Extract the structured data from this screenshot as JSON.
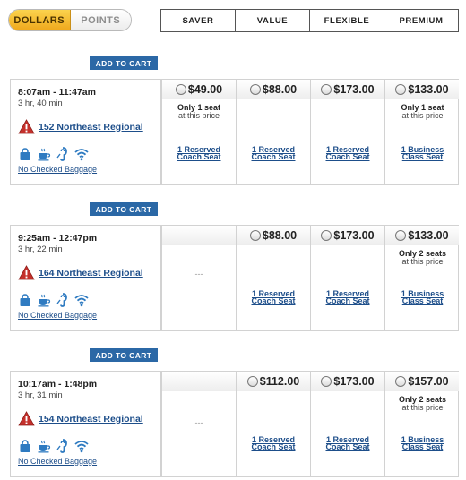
{
  "toggle": {
    "dollars": "DOLLARS",
    "points": "POINTS"
  },
  "columns": [
    "SAVER",
    "VALUE",
    "FLEXIBLE",
    "PREMIUM"
  ],
  "add_to_cart": "ADD TO CART",
  "no_fare": "---",
  "no_baggage": "No Checked Baggage",
  "flights": [
    {
      "times": "8:07am - 11:47am",
      "duration": "3 hr, 40 min",
      "flight": "152 Northeast Regional",
      "prices": [
        "$49.00",
        "$88.00",
        "$173.00",
        "$133.00"
      ],
      "seats": [
        {
          "line1": "Only 1 seat",
          "line2": "at this price"
        },
        null,
        null,
        {
          "line1": "Only 1 seat",
          "line2": "at this price"
        }
      ],
      "fares": [
        {
          "l1": "1 Reserved",
          "l2": "Coach Seat"
        },
        {
          "l1": "1 Reserved",
          "l2": "Coach Seat"
        },
        {
          "l1": "1 Reserved",
          "l2": "Coach Seat"
        },
        {
          "l1": "1 Business",
          "l2": "Class Seat"
        }
      ]
    },
    {
      "times": "9:25am - 12:47pm",
      "duration": "3 hr, 22 min",
      "flight": "164 Northeast Regional",
      "prices": [
        null,
        "$88.00",
        "$173.00",
        "$133.00"
      ],
      "seats": [
        null,
        null,
        null,
        {
          "line1": "Only 2 seats",
          "line2": "at this price"
        }
      ],
      "fares": [
        null,
        {
          "l1": "1 Reserved",
          "l2": "Coach Seat"
        },
        {
          "l1": "1 Reserved",
          "l2": "Coach Seat"
        },
        {
          "l1": "1 Business",
          "l2": "Class Seat"
        }
      ]
    },
    {
      "times": "10:17am - 1:48pm",
      "duration": "3 hr, 31 min",
      "flight": "154 Northeast Regional",
      "prices": [
        null,
        "$112.00",
        "$173.00",
        "$157.00"
      ],
      "seats": [
        null,
        null,
        null,
        {
          "line1": "Only 2 seats",
          "line2": "at this price"
        }
      ],
      "fares": [
        null,
        {
          "l1": "1 Reserved",
          "l2": "Coach Seat"
        },
        {
          "l1": "1 Reserved",
          "l2": "Coach Seat"
        },
        {
          "l1": "1 Business",
          "l2": "Class Seat"
        }
      ]
    }
  ]
}
